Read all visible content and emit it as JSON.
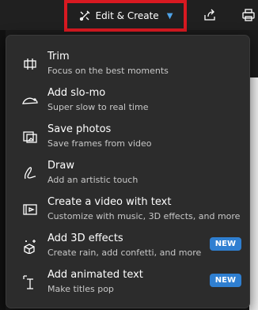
{
  "toolbar": {
    "edit_create_label": "Edit & Create"
  },
  "menu": {
    "items": [
      {
        "title": "Trim",
        "desc": "Focus on the best moments",
        "icon": "trim-icon"
      },
      {
        "title": "Add slo-mo",
        "desc": "Super slow to real time",
        "icon": "slo-mo-icon"
      },
      {
        "title": "Save photos",
        "desc": "Save frames from video",
        "icon": "save-photos-icon"
      },
      {
        "title": "Draw",
        "desc": "Add an artistic touch",
        "icon": "draw-icon"
      },
      {
        "title": "Create a video with text",
        "desc": "Customize with music, 3D effects, and more",
        "icon": "video-text-icon"
      },
      {
        "title": "Add 3D effects",
        "desc": "Create rain, add confetti, and more",
        "icon": "3d-effects-icon",
        "badge": "NEW"
      },
      {
        "title": "Add animated text",
        "desc": "Make titles pop",
        "icon": "animated-text-icon",
        "badge": "NEW"
      }
    ]
  },
  "colors": {
    "highlight_border": "#d81921",
    "accent": "#2f7fd1",
    "menu_bg": "#2c2c2c"
  }
}
